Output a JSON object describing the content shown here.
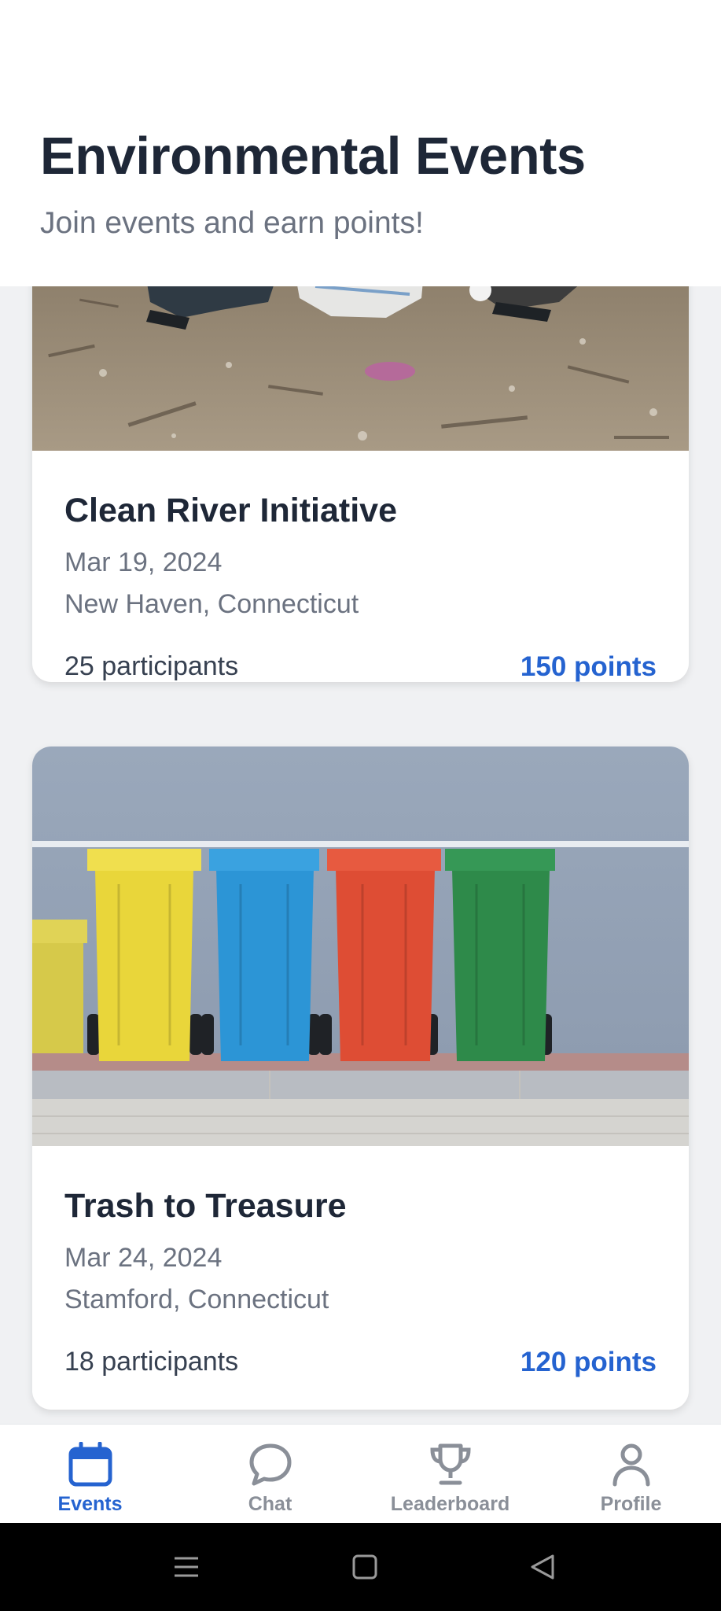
{
  "header": {
    "title": "Environmental Events",
    "subtitle": "Join events and earn points!"
  },
  "events": [
    {
      "title": "Clean River Initiative",
      "date": "Mar 19, 2024",
      "location": "New Haven, Connecticut",
      "participants": "25 participants",
      "points": "150 points",
      "image": "beach-cleanup-photo"
    },
    {
      "title": "Trash to Treasure",
      "date": "Mar 24, 2024",
      "location": "Stamford, Connecticut",
      "participants": "18 participants",
      "points": "120 points",
      "image": "recycling-bins-photo"
    }
  ],
  "nav": {
    "items": [
      {
        "label": "Events",
        "icon": "calendar-icon",
        "active": true
      },
      {
        "label": "Chat",
        "icon": "chat-bubble-icon",
        "active": false
      },
      {
        "label": "Leaderboard",
        "icon": "trophy-icon",
        "active": false
      },
      {
        "label": "Profile",
        "icon": "person-icon",
        "active": false
      }
    ]
  },
  "colors": {
    "accent": "#2563d0",
    "title": "#1e2737",
    "muted": "#6b7280",
    "background": "#f0f1f3"
  }
}
